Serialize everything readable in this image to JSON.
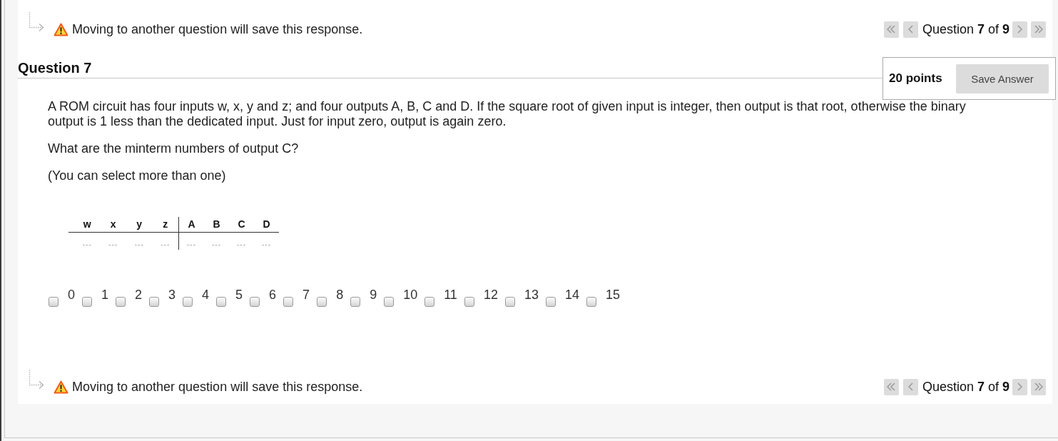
{
  "notice_top": {
    "notice": "Moving to another question will save this response.",
    "position": "Question **7** of **9**"
  },
  "question": {
    "title": "Question 7",
    "points": "20 points",
    "save_button": "Save Answer",
    "paragraphs": [
      "A ROM circuit has four inputs w, x, y and z; and four outputs A, B, C and D. If the square root of given input is integer, then output is that root, otherwise the binary output is 1 less than the dedicated input. Just for input zero, output is again zero.",
      "What are the minterm numbers of output C?",
      "(You can select more than one)"
    ],
    "truth_table": {
      "inputs": [
        "w",
        "x",
        "y",
        "z"
      ],
      "outputs": [
        "A",
        "B",
        "C",
        "D"
      ],
      "rows": [
        {
          "inputs": [
            "---",
            "---",
            "---",
            "---"
          ],
          "outputs": [
            "---",
            "---",
            "---",
            "---"
          ]
        }
      ]
    },
    "options": [
      {
        "label": "0",
        "checked": false
      },
      {
        "label": "1",
        "checked": false
      },
      {
        "label": "2",
        "checked": false
      },
      {
        "label": "3",
        "checked": false
      },
      {
        "label": "4",
        "checked": false
      },
      {
        "label": "5",
        "checked": false
      },
      {
        "label": "6",
        "checked": false
      },
      {
        "label": "7",
        "checked": false
      },
      {
        "label": "8",
        "checked": false
      },
      {
        "label": "9",
        "checked": false
      },
      {
        "label": "10",
        "checked": false
      },
      {
        "label": "11",
        "checked": false
      },
      {
        "label": "12",
        "checked": false
      },
      {
        "label": "13",
        "checked": false
      },
      {
        "label": "14",
        "checked": false
      },
      {
        "label": "15",
        "checked": false
      }
    ]
  },
  "notice_bottom": {
    "notice": "Moving to another question will save this response.",
    "position": "Question **7** of **9**"
  }
}
